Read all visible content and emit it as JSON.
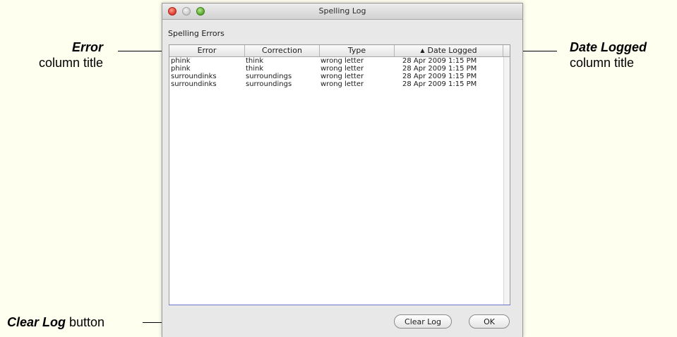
{
  "window": {
    "title": "Spelling Log",
    "group_label": "Spelling Errors"
  },
  "table": {
    "columns": [
      "Error",
      "Correction",
      "Type",
      "Date Logged"
    ],
    "sort_indicator": "▲",
    "rows": [
      [
        "phink",
        "think",
        "wrong letter",
        "28 Apr 2009 1:15 PM"
      ],
      [
        "phink",
        "think",
        "wrong letter",
        "28 Apr 2009 1:15 PM"
      ],
      [
        "surroundinks",
        "surroundings",
        "wrong letter",
        "28 Apr 2009 1:15 PM"
      ],
      [
        "surroundinks",
        "surroundings",
        "wrong letter",
        "28 Apr 2009 1:15 PM"
      ]
    ]
  },
  "buttons": {
    "clear_log": "Clear Log",
    "ok": "OK"
  },
  "callouts": {
    "error_title": "Error",
    "error_sub": "column title",
    "date_title": "Date Logged",
    "date_sub": "column title",
    "clear_title": "Clear Log",
    "clear_sub": " button"
  },
  "colors": {
    "page_background": "#fffff0",
    "close_light": "#d9392c",
    "zoom_light": "#58a82e"
  }
}
